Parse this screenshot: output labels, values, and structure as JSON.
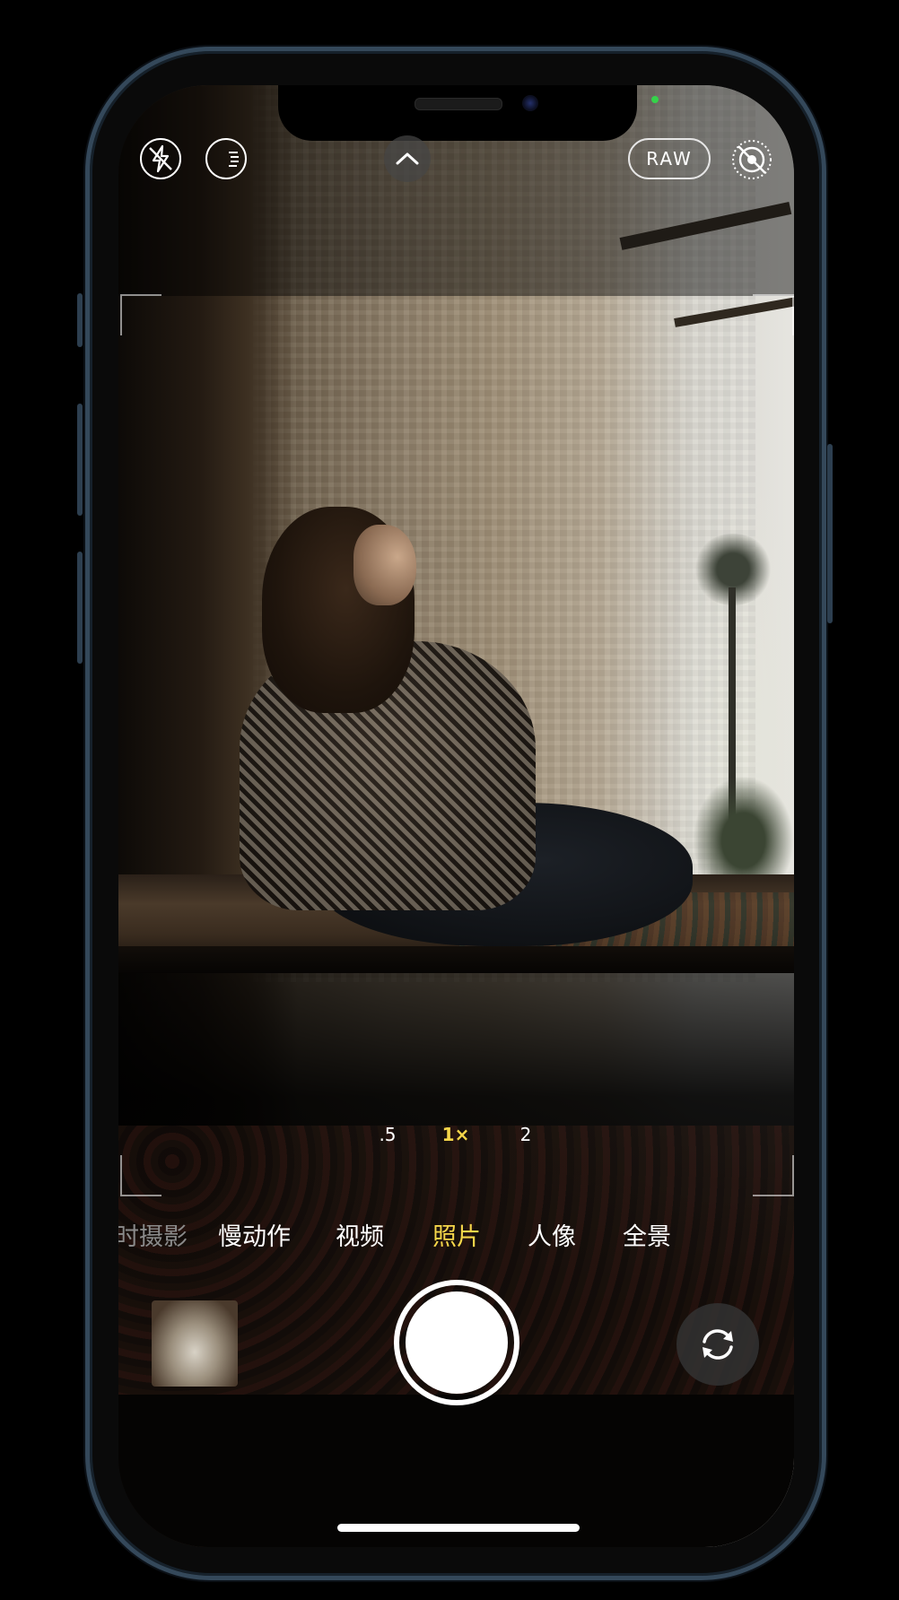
{
  "top_controls": {
    "flash": "flash-off",
    "night_mode": "night-mode",
    "expand": "chevron-up",
    "raw_label": "RAW",
    "live_photo": "live-photo-off"
  },
  "zoom": {
    "options": [
      ".5",
      "1×",
      "2"
    ],
    "selected": "1×"
  },
  "modes": {
    "items": [
      "时摄影",
      "慢动作",
      "视频",
      "照片",
      "人像",
      "全景"
    ],
    "selected": "照片"
  },
  "colors": {
    "accent": "#f5d64a",
    "frame": "#34485a"
  }
}
